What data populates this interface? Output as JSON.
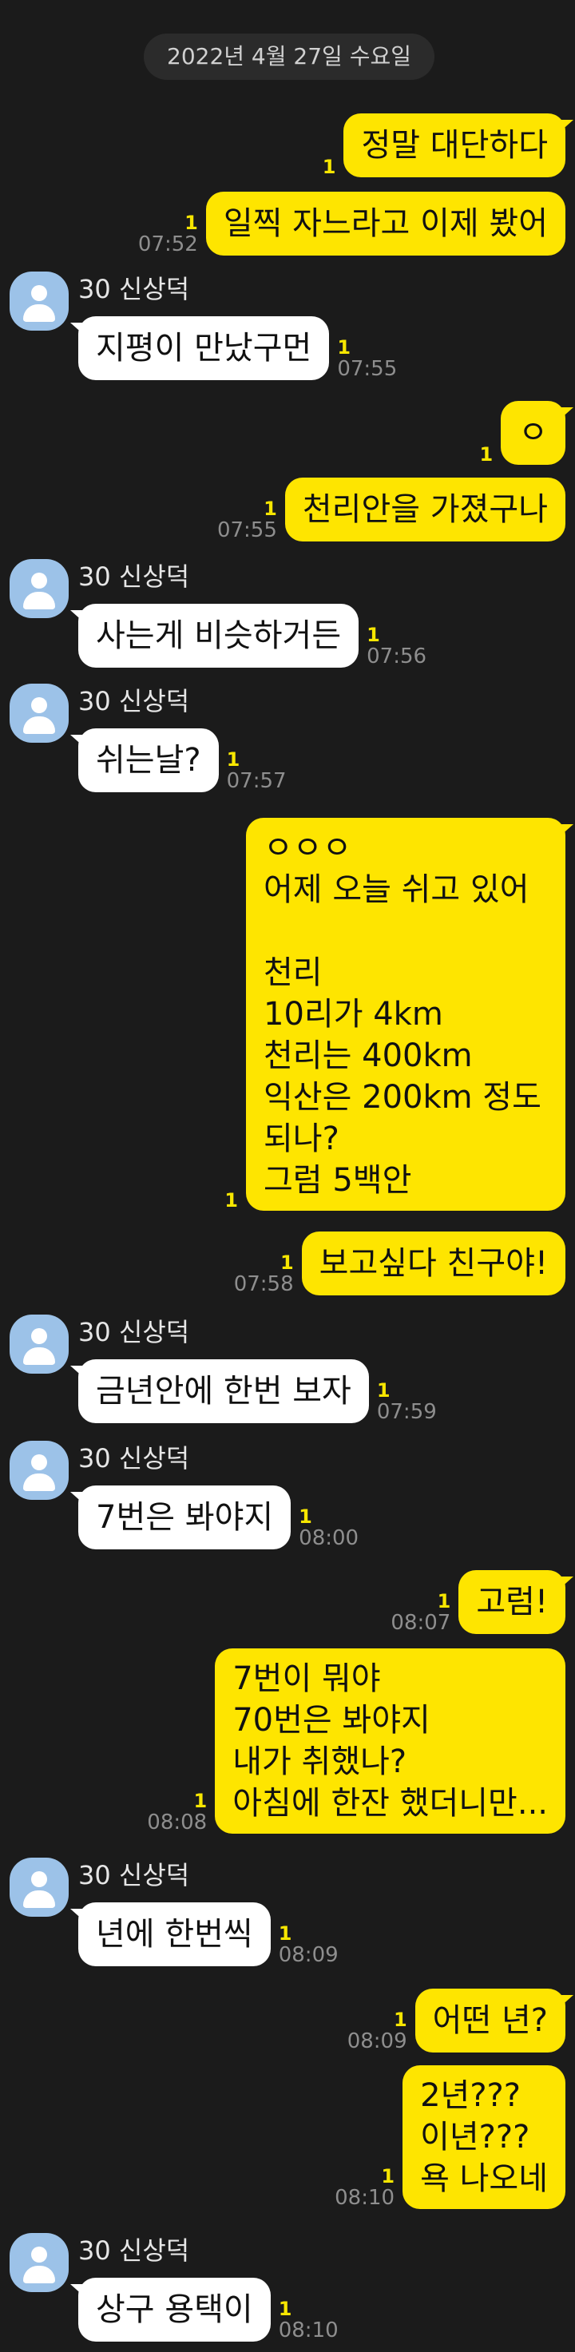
{
  "date_divider": "2022년 4월 27일 수요일",
  "sender_name": "30 신상덕",
  "messages": [
    {
      "side": "mine",
      "text": "정말 대단하다",
      "unread": "1",
      "time": ""
    },
    {
      "side": "mine",
      "text": "일찍 자느라고 이제 봤어",
      "unread": "1",
      "time": "07:52"
    },
    {
      "side": "theirs",
      "text": "지평이 만났구먼",
      "unread": "1",
      "time": "07:55"
    },
    {
      "side": "mine",
      "text": "ㅇ",
      "unread": "1",
      "time": ""
    },
    {
      "side": "mine",
      "text": "천리안을 가졌구나",
      "unread": "1",
      "time": "07:55"
    },
    {
      "side": "theirs",
      "text": "사는게 비슷하거든",
      "unread": "1",
      "time": "07:56"
    },
    {
      "side": "theirs",
      "text": "쉬는날?",
      "unread": "1",
      "time": "07:57"
    },
    {
      "side": "mine",
      "text": "ㅇㅇㅇ\n어제 오늘 쉬고 있어\n\n천리\n10리가 4km\n천리는 400km\n익산은 200km 정도\n되나?\n그럼 5백안",
      "unread": "1",
      "time": ""
    },
    {
      "side": "mine",
      "text": "보고싶다 친구야!",
      "unread": "1",
      "time": "07:58"
    },
    {
      "side": "theirs",
      "text": "금년안에 한번 보자",
      "unread": "1",
      "time": "07:59"
    },
    {
      "side": "theirs",
      "text": "7번은 봐야지",
      "unread": "1",
      "time": "08:00"
    },
    {
      "side": "mine",
      "text": "고럼!",
      "unread": "1",
      "time": "08:07"
    },
    {
      "side": "mine",
      "text": "7번이 뭐야\n70번은 봐야지\n내가 취했나?\n아침에 한잔 했더니만...",
      "unread": "1",
      "time": "08:08"
    },
    {
      "side": "theirs",
      "text": "년에 한번씩",
      "unread": "1",
      "time": "08:09"
    },
    {
      "side": "mine",
      "text": "어떤 년?",
      "unread": "1",
      "time": "08:09"
    },
    {
      "side": "mine",
      "text": "2년???\n이년???\n욕 나오네",
      "unread": "1",
      "time": "08:10"
    },
    {
      "side": "theirs",
      "text": "상구 용택이",
      "unread": "1",
      "time": "08:10"
    }
  ]
}
